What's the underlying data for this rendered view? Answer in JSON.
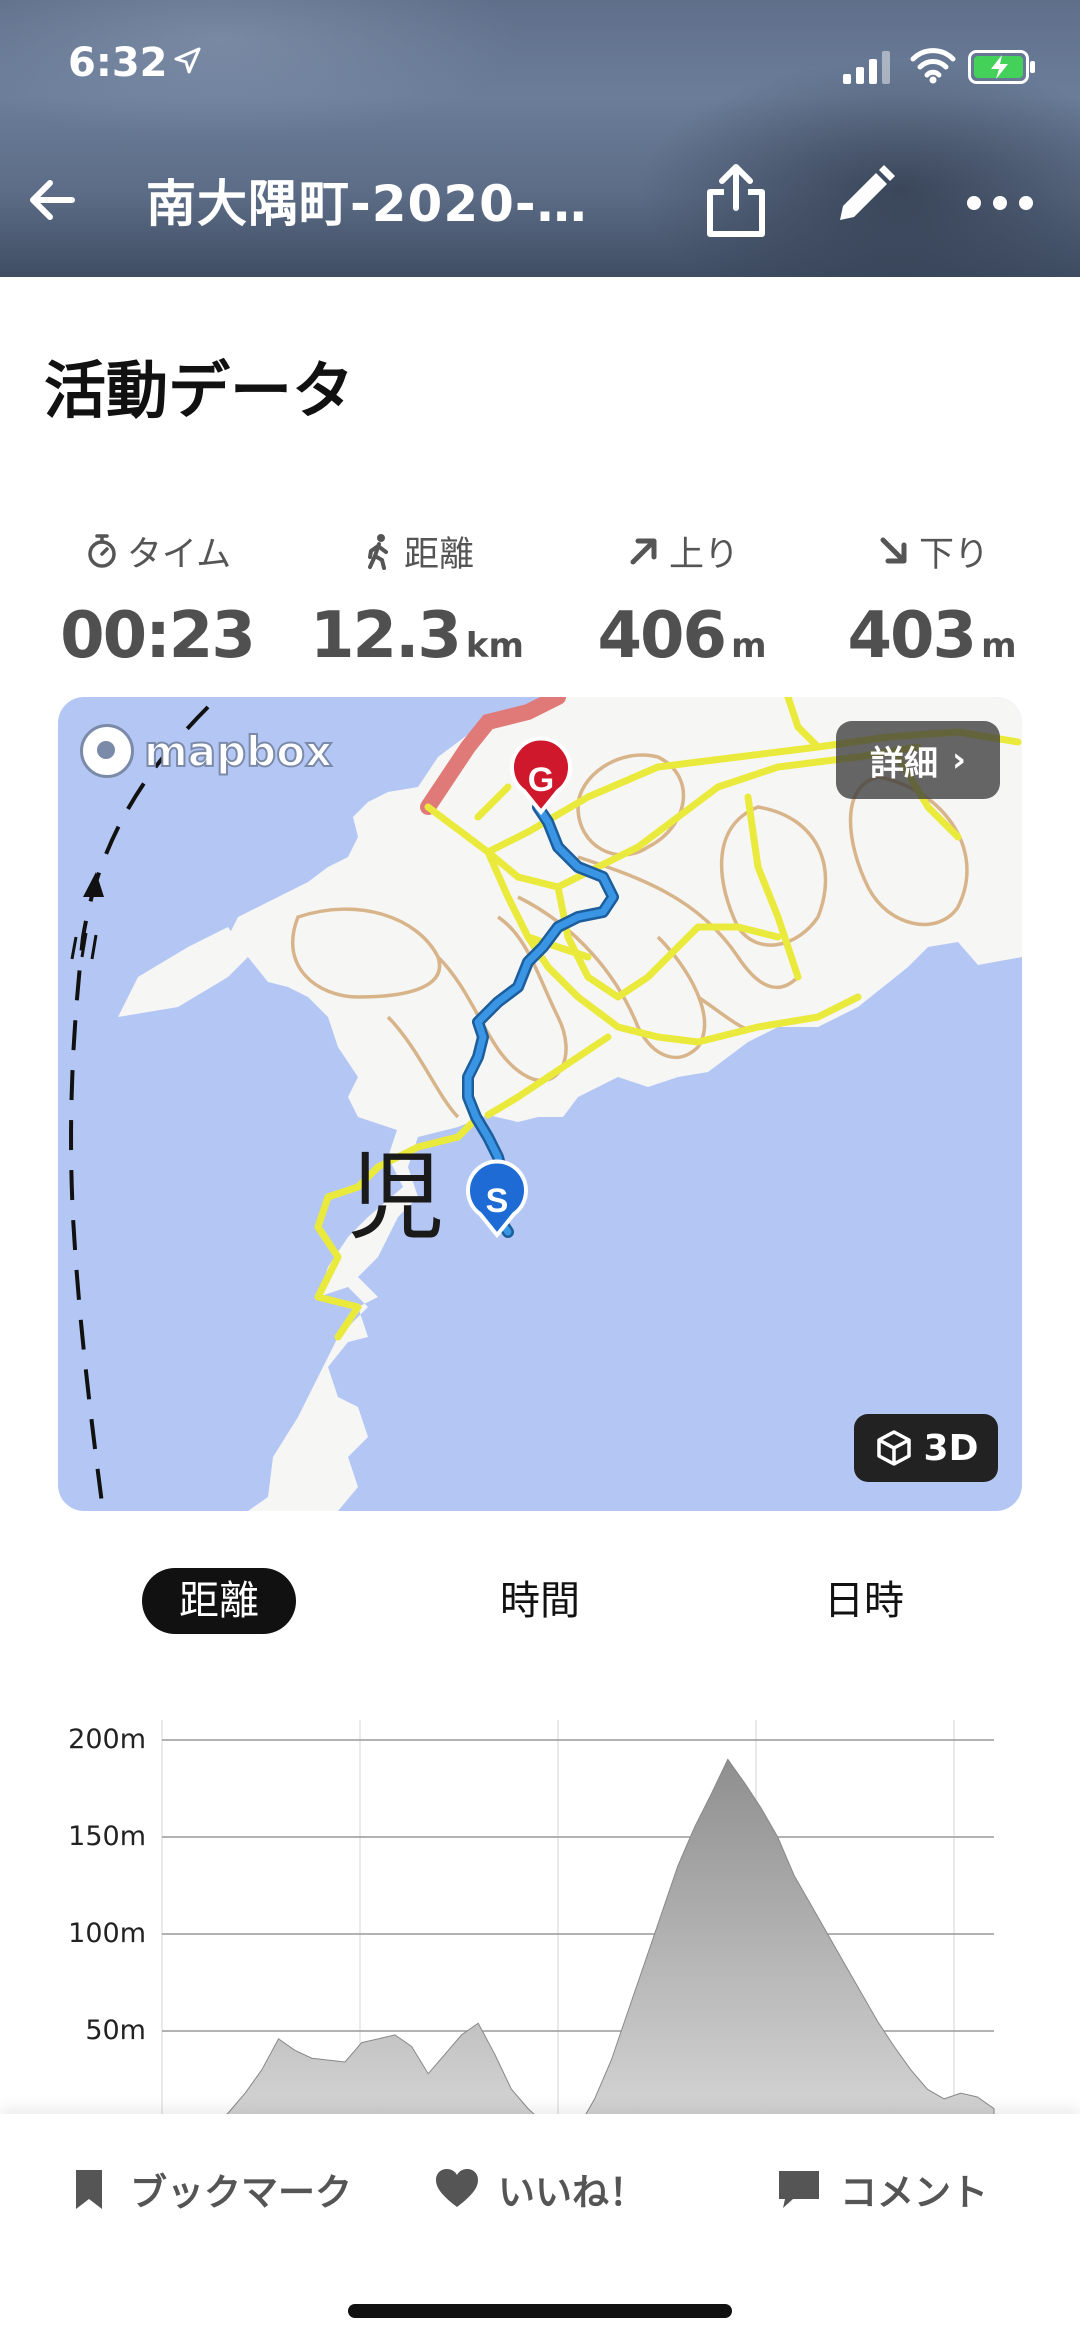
{
  "status_bar": {
    "time": "6:32",
    "location_icon": "location-arrow-icon",
    "signal_icon": "cell-signal-icon",
    "wifi_icon": "wifi-icon",
    "battery_icon": "battery-charging-icon"
  },
  "nav": {
    "back_icon": "back-arrow-icon",
    "title": "南大隅町-2020-…",
    "share_icon": "share-icon",
    "edit_icon": "pencil-icon",
    "more_icon": "more-dots-icon"
  },
  "section_title": "活動データ",
  "stats": [
    {
      "icon": "stopwatch-icon",
      "label": "タイム",
      "value": "00:23",
      "unit": ""
    },
    {
      "icon": "walker-icon",
      "label": "距離",
      "value": "12.3",
      "unit": "km"
    },
    {
      "icon": "arrow-up-right-icon",
      "label": "上り",
      "value": "406",
      "unit": "m"
    },
    {
      "icon": "arrow-down-right-icon",
      "label": "下り",
      "value": "403",
      "unit": "m"
    }
  ],
  "map": {
    "attribution": "mapbox",
    "detail_label": "詳細",
    "detail_chevron": "›",
    "btn_3d_label": "3D",
    "place_label": "児",
    "goal_marker": "G",
    "start_marker": "S",
    "colors": {
      "sea": "#b4c7f4",
      "land": "#f6f6f4",
      "route": "#2f86d6",
      "trail": "#eaea3c",
      "contour": "#d8b48a",
      "road": "#e07a78"
    }
  },
  "segments": {
    "items": [
      "距離",
      "時間",
      "日時"
    ],
    "active_index": 0
  },
  "chart_data": {
    "type": "area",
    "title": "",
    "xlabel": "",
    "ylabel": "",
    "ylim": [
      0,
      200
    ],
    "yticks": [
      "200m",
      "150m",
      "100m",
      "50m"
    ],
    "grid": true,
    "series": [
      {
        "values": [
          5,
          0,
          0,
          0,
          8,
          18,
          30,
          46,
          40,
          36,
          35,
          34,
          44,
          46,
          48,
          42,
          28,
          38,
          48,
          54,
          38,
          20,
          10,
          2,
          0,
          0,
          15,
          35,
          60,
          85,
          110,
          135,
          155,
          172,
          190,
          178,
          165,
          150,
          130,
          115,
          100,
          85,
          70,
          55,
          42,
          30,
          20,
          15,
          18,
          16,
          10
        ]
      }
    ]
  },
  "actions": [
    {
      "icon": "bookmark-icon",
      "label": "ブックマーク"
    },
    {
      "icon": "heart-icon",
      "label": "いいね！"
    },
    {
      "icon": "comment-icon",
      "label": "コメント"
    }
  ]
}
